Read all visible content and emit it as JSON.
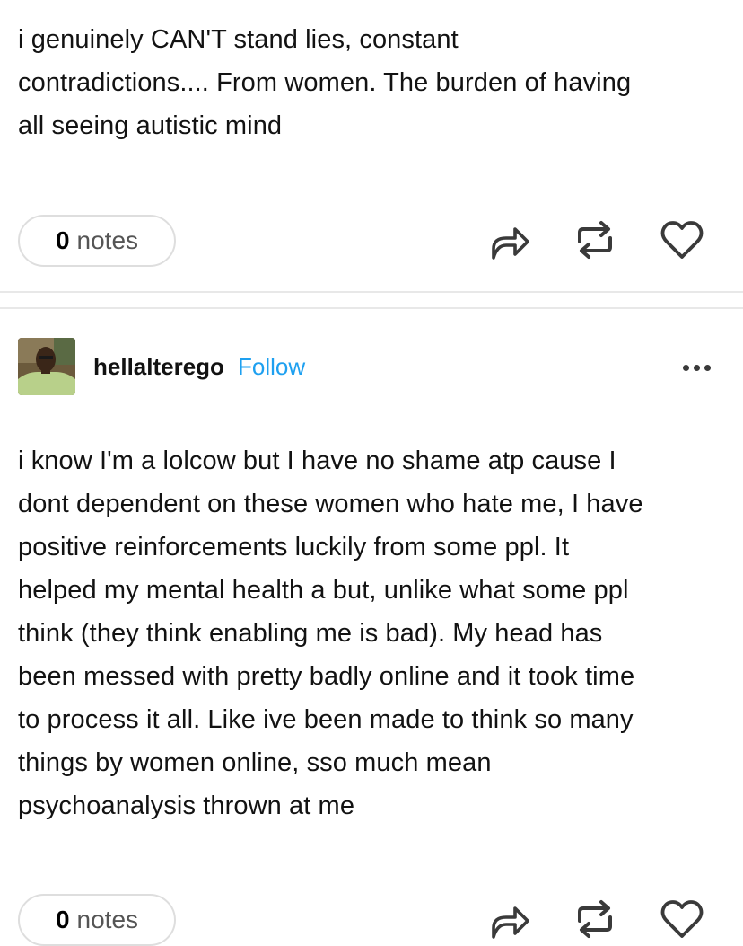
{
  "post1": {
    "lines": [
      "i genuinely CAN'T stand lies, constant",
      "contradictions.... From women. The burden of having",
      "all seeing autistic mind"
    ],
    "notes_count": "0",
    "notes_label": "notes"
  },
  "post2": {
    "username": "hellalterego",
    "follow_label": "Follow",
    "lines": [
      "i know I'm a lolcow but I have no shame atp cause I",
      "dont dependent on these women who hate me, I have",
      "positive reinforcements luckily from some ppl. It",
      "helped my mental health a but, unlike what some ppl",
      "think (they think enabling me is bad). My head has",
      "been messed with pretty badly online and it took time",
      "to process it all. Like ive been made to think so many",
      "things by women online, sso much mean",
      "psychoanalysis thrown at me"
    ],
    "notes_count": "0",
    "notes_label": "notes"
  },
  "icons": {
    "share": "share-icon",
    "reblog": "reblog-icon",
    "like": "heart-icon",
    "more": "more-options-icon"
  },
  "colors": {
    "follow": "#1ea0f0",
    "text": "#121212",
    "icon": "#3a3a3a"
  }
}
